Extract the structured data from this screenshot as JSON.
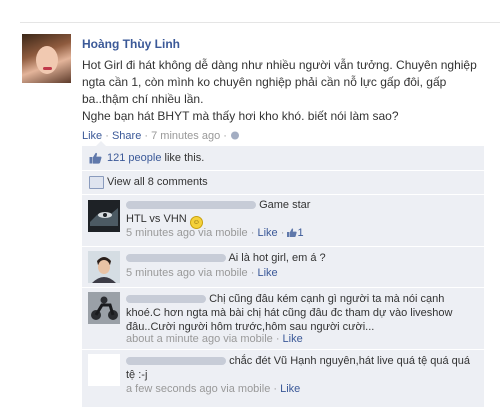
{
  "post": {
    "author": "Hoàng Thùy Linh",
    "lines": [
      "Hot Girl đi hát không dễ dàng như nhiều người vẫn tưởng. Chuyên nghiệp ngta cần 1, còn mình ko chuyên nghiệp phải cần nỗ lực gấp đôi, gấp ba..thậm chí nhiều lần.",
      "Nghe bạn hát BHYT mà thấy hơi kho khó. biết nói làm sao?"
    ],
    "meta": {
      "like": "Like",
      "share": "Share",
      "sep": " · ",
      "time": "7 minutes ago",
      "tail": " · "
    }
  },
  "likes": {
    "count_link": "121 people",
    "rest": " like this."
  },
  "view_all": "View all 8 comments",
  "comments": [
    {
      "name": "",
      "text": "Game star",
      "text2": "HTL vs VHN",
      "time": "5 minutes ago via mobile",
      "like": "Like",
      "like_count": "1",
      "avatar": "game"
    },
    {
      "name": "",
      "text": "Ai là hot girl, em á ?",
      "time": "5 minutes ago via mobile",
      "like": "Like",
      "avatar": "boy"
    },
    {
      "name": "",
      "text": "Chị cũng đâu kém cạnh gì người ta mà nói cạnh khoé.C hơn ngta mà bài chị hát cũng đâu đc tham dự vào liveshow đâu..Cười người hôm trước,hôm sau người cười...",
      "time": "about a minute ago via mobile",
      "like": "Like",
      "avatar": "moto"
    },
    {
      "name": "",
      "text": "chắc đét Vũ Hạnh nguyên,hát live quá tệ quá quá tệ :-j",
      "time": "a few seconds ago via mobile",
      "like": "Like",
      "avatar": "blank"
    }
  ],
  "colors": {
    "link": "#3b5998",
    "ufi_bg": "#edeff4",
    "meta": "#999999"
  }
}
